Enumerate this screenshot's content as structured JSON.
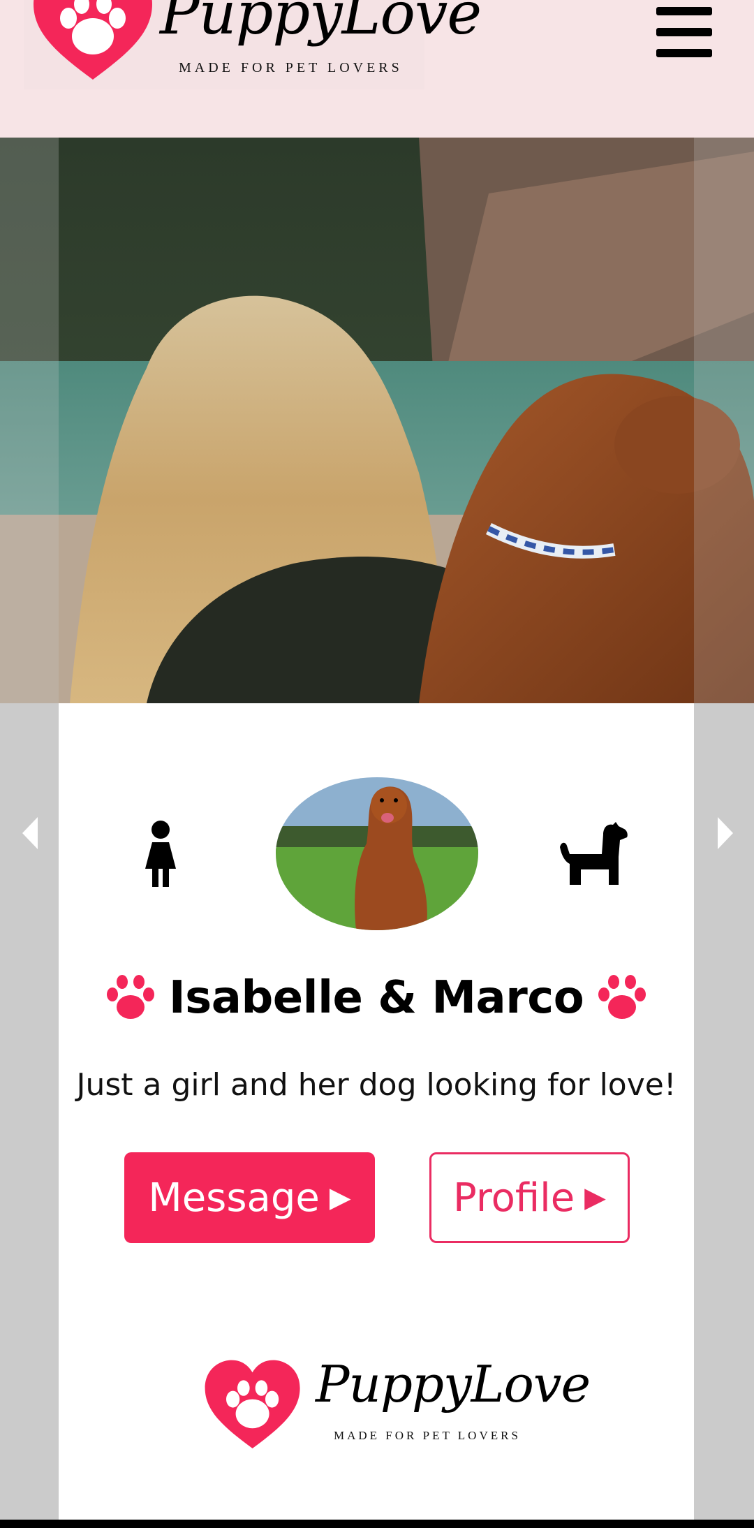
{
  "header": {
    "brand_name": "PuppyLove",
    "brand_tagline": "MADE FOR PET LOVERS",
    "menu_icon": "hamburger-menu-icon"
  },
  "hero": {
    "image": "photo of woman with long blonde hair hugging a golden retriever by a lake"
  },
  "carousel": {
    "prev_icon": "chevron-left-icon",
    "next_icon": "chevron-right-icon"
  },
  "profile": {
    "owner_icon": "woman-icon",
    "pet_icon": "dog-icon",
    "pet_photo": "golden retriever sitting on grass",
    "name": "Isabelle & Marco",
    "tagline": "Just a girl and her dog looking for love!",
    "message_label": "Message",
    "profile_label": "Profile"
  },
  "footer": {
    "brand_name": "PuppyLove",
    "brand_tagline": "MADE FOR PET LOVERS"
  },
  "colors": {
    "accent": "#f42659",
    "header_bg": "#f7e4e6",
    "side_bg": "#cbcbcb"
  }
}
